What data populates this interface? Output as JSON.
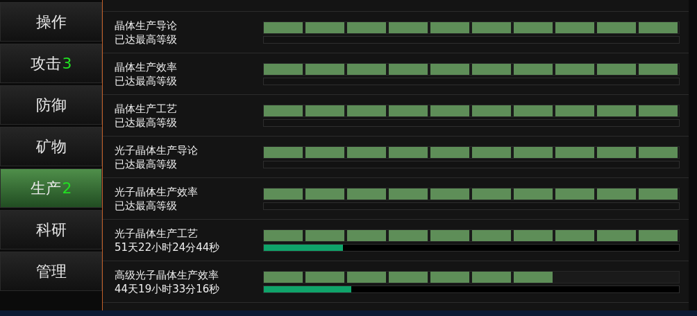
{
  "sidebar": {
    "items": [
      {
        "label": "操作",
        "selected": false
      },
      {
        "label": "攻击",
        "badge": "3",
        "selected": false
      },
      {
        "label": "防御",
        "selected": false
      },
      {
        "label": "矿物",
        "selected": false
      },
      {
        "label": "生产",
        "badge": "2",
        "selected": true
      },
      {
        "label": "科研",
        "selected": false
      },
      {
        "label": "管理",
        "selected": false
      }
    ]
  },
  "upgrades": [
    {
      "name": "晶体生产导论",
      "status": "已达最高等级",
      "level": 1
    },
    {
      "name": "晶体生产效率",
      "status": "已达最高等级",
      "level": 1
    },
    {
      "name": "晶体生产工艺",
      "status": "已达最高等级",
      "level": 1
    },
    {
      "name": "光子晶体生产导论",
      "status": "已达最高等级",
      "level": 1
    },
    {
      "name": "光子晶体生产效率",
      "status": "已达最高等级",
      "level": 1
    },
    {
      "name": "光子晶体生产工艺",
      "status": "51天22小时24分44秒",
      "level": 1,
      "progress": {
        "level": 0.19
      }
    },
    {
      "name": "高级光子晶体生产效率",
      "status": "44天19小时33分16秒",
      "level": 0.7,
      "progress": {
        "level": 0.21
      }
    }
  ]
}
